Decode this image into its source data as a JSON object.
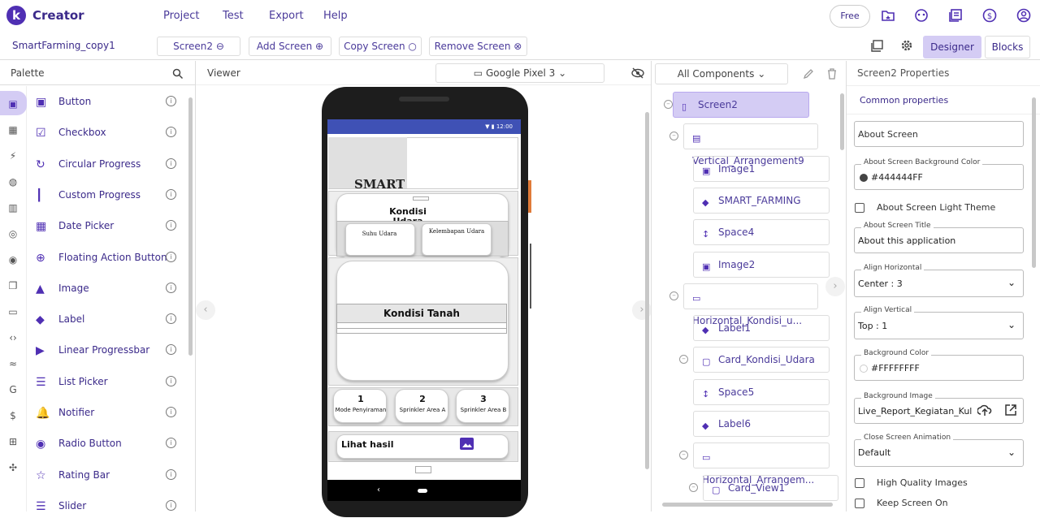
{
  "app": {
    "name": "Creator",
    "logo_letter": "k"
  },
  "menu": [
    "Project",
    "Test",
    "Export",
    "Help"
  ],
  "plan_badge": "Free",
  "toolbar": {
    "project_name": "SmartFarming_copy1",
    "screen_select": "Screen2",
    "add_screen": "Add Screen",
    "copy_screen": "Copy Screen",
    "remove_screen": "Remove Screen",
    "designer": "Designer",
    "blocks": "Blocks"
  },
  "palette": {
    "title": "Palette",
    "items": [
      {
        "label": "Button",
        "icon": "button-icon"
      },
      {
        "label": "Checkbox",
        "icon": "checkbox-icon"
      },
      {
        "label": "Circular Progress",
        "icon": "circular-progress-icon"
      },
      {
        "label": "Custom Progress",
        "icon": "custom-progress-icon"
      },
      {
        "label": "Date Picker",
        "icon": "calendar-icon"
      },
      {
        "label": "Floating Action Button",
        "icon": "fab-icon"
      },
      {
        "label": "Image",
        "icon": "image-icon"
      },
      {
        "label": "Label",
        "icon": "label-icon"
      },
      {
        "label": "Linear Progressbar",
        "icon": "linear-progress-icon"
      },
      {
        "label": "List Picker",
        "icon": "list-icon"
      },
      {
        "label": "Notifier",
        "icon": "bell-icon"
      },
      {
        "label": "Radio Button",
        "icon": "radio-icon"
      },
      {
        "label": "Rating Bar",
        "icon": "star-icon"
      },
      {
        "label": "Slider",
        "icon": "slider-icon"
      }
    ]
  },
  "viewer": {
    "title": "Viewer",
    "device": "Google Pixel 3",
    "status_time": "12:00",
    "screen": {
      "banner_text": "SMART",
      "card1_title": "Kondisi Udara",
      "card1_left": "Suhu Udara",
      "card1_right": "Kelembapan Udara",
      "card2_title": "Kondisi Tanah",
      "buttons": [
        {
          "num": "1",
          "label": "Mode Penyiraman"
        },
        {
          "num": "2",
          "label": "Sprinkler Area A"
        },
        {
          "num": "3",
          "label": "Sprinkler Area B"
        }
      ],
      "monitor_label": "Lihat hasil monitoring"
    }
  },
  "components": {
    "filter": "All Components",
    "tree": [
      {
        "label": "Screen2",
        "icon": "phone-icon",
        "level": 0,
        "selected": true
      },
      {
        "label": "Vertical_Arrangement9",
        "icon": "vertical-arrangement-icon",
        "level": 1
      },
      {
        "label": "Image1",
        "icon": "image-icon",
        "level": 2
      },
      {
        "label": "SMART_FARMING",
        "icon": "label-icon",
        "level": 2
      },
      {
        "label": "Space4",
        "icon": "space-icon",
        "level": 2
      },
      {
        "label": "Image2",
        "icon": "image-icon",
        "level": 2
      },
      {
        "label": "Horizontal_Kondisi_u...",
        "icon": "horizontal-arrangement-icon",
        "level": 1
      },
      {
        "label": "Label1",
        "icon": "label-icon",
        "level": 2
      },
      {
        "label": "Card_Kondisi_Udara",
        "icon": "card-icon",
        "level": 2
      },
      {
        "label": "Space5",
        "icon": "space-icon",
        "level": 3
      },
      {
        "label": "Label6",
        "icon": "label-icon",
        "level": 3
      },
      {
        "label": "Horizontal_Arrangem...",
        "icon": "horizontal-arrangement-icon",
        "level": 3
      },
      {
        "label": "Card_View1",
        "icon": "card-icon",
        "level": 4
      }
    ]
  },
  "properties": {
    "title": "Screen2 Properties",
    "section": "Common properties",
    "about_screen_placeholder": "About Screen",
    "bg_color_label": "About Screen Background Color",
    "bg_color_value": "#444444FF",
    "light_theme_label": "About Screen Light Theme",
    "title_label": "About Screen Title",
    "title_value": "About this application",
    "align_h_label": "Align Horizontal",
    "align_h_value": "Center : 3",
    "align_v_label": "Align Vertical",
    "align_v_value": "Top : 1",
    "background_color_label": "Background Color",
    "background_color_value": "#FFFFFFFF",
    "background_image_label": "Background Image",
    "background_image_value": "Live_Report_Kegiatan_Kul...",
    "close_anim_label": "Close Screen Animation",
    "close_anim_value": "Default",
    "high_quality_label": "High Quality Images",
    "keep_screen_label": "Keep Screen On"
  },
  "colors": {
    "accent": "#4f2fb3",
    "selected": "#d4ccf4",
    "status_bar": "#3f51b5"
  }
}
